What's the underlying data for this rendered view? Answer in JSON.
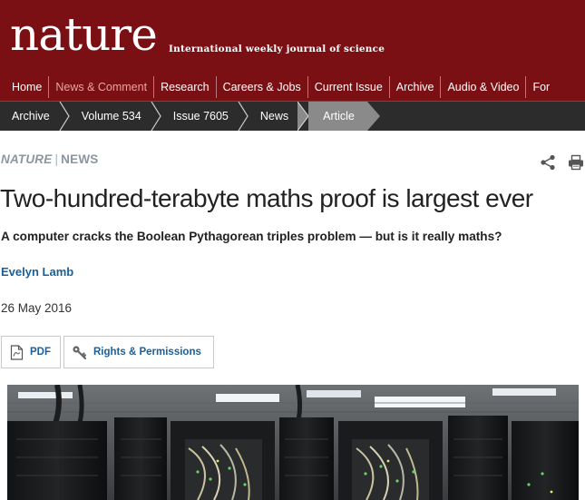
{
  "masthead": {
    "logo": "nature",
    "tagline": "International weekly journal of science",
    "background": "#7a1013"
  },
  "main_nav": {
    "items": [
      {
        "label": "Home",
        "active": false
      },
      {
        "label": "News & Comment",
        "active": true
      },
      {
        "label": "Research",
        "active": false
      },
      {
        "label": "Careers & Jobs",
        "active": false
      },
      {
        "label": "Current Issue",
        "active": false
      },
      {
        "label": "Archive",
        "active": false
      },
      {
        "label": "Audio & Video",
        "active": false
      },
      {
        "label": "For",
        "active": false
      }
    ]
  },
  "breadcrumb": {
    "items": [
      "Archive",
      "Volume 534",
      "Issue 7605",
      "News"
    ],
    "current": "Article"
  },
  "article": {
    "journal": "NATURE",
    "section": "NEWS",
    "separator": "|",
    "title": "Two-hundred-terabyte maths proof is largest ever",
    "standfirst": "A computer cracks the Boolean Pythagorean triples problem — but is it really maths?",
    "author": "Evelyn Lamb",
    "date": "26 May 2016",
    "pdf_label": "PDF",
    "rights_label": "Rights & Permissions"
  },
  "icons": {
    "share": "share-icon",
    "print": "print-icon",
    "pdf": "pdf-document-icon",
    "rights": "key-icon"
  },
  "colors": {
    "brand": "#7a1013",
    "link": "#1a5f99",
    "section_label": "#8a97a3",
    "breadcrumb_bg": "#2c2c2c",
    "breadcrumb_current": "#8a8a8a"
  }
}
